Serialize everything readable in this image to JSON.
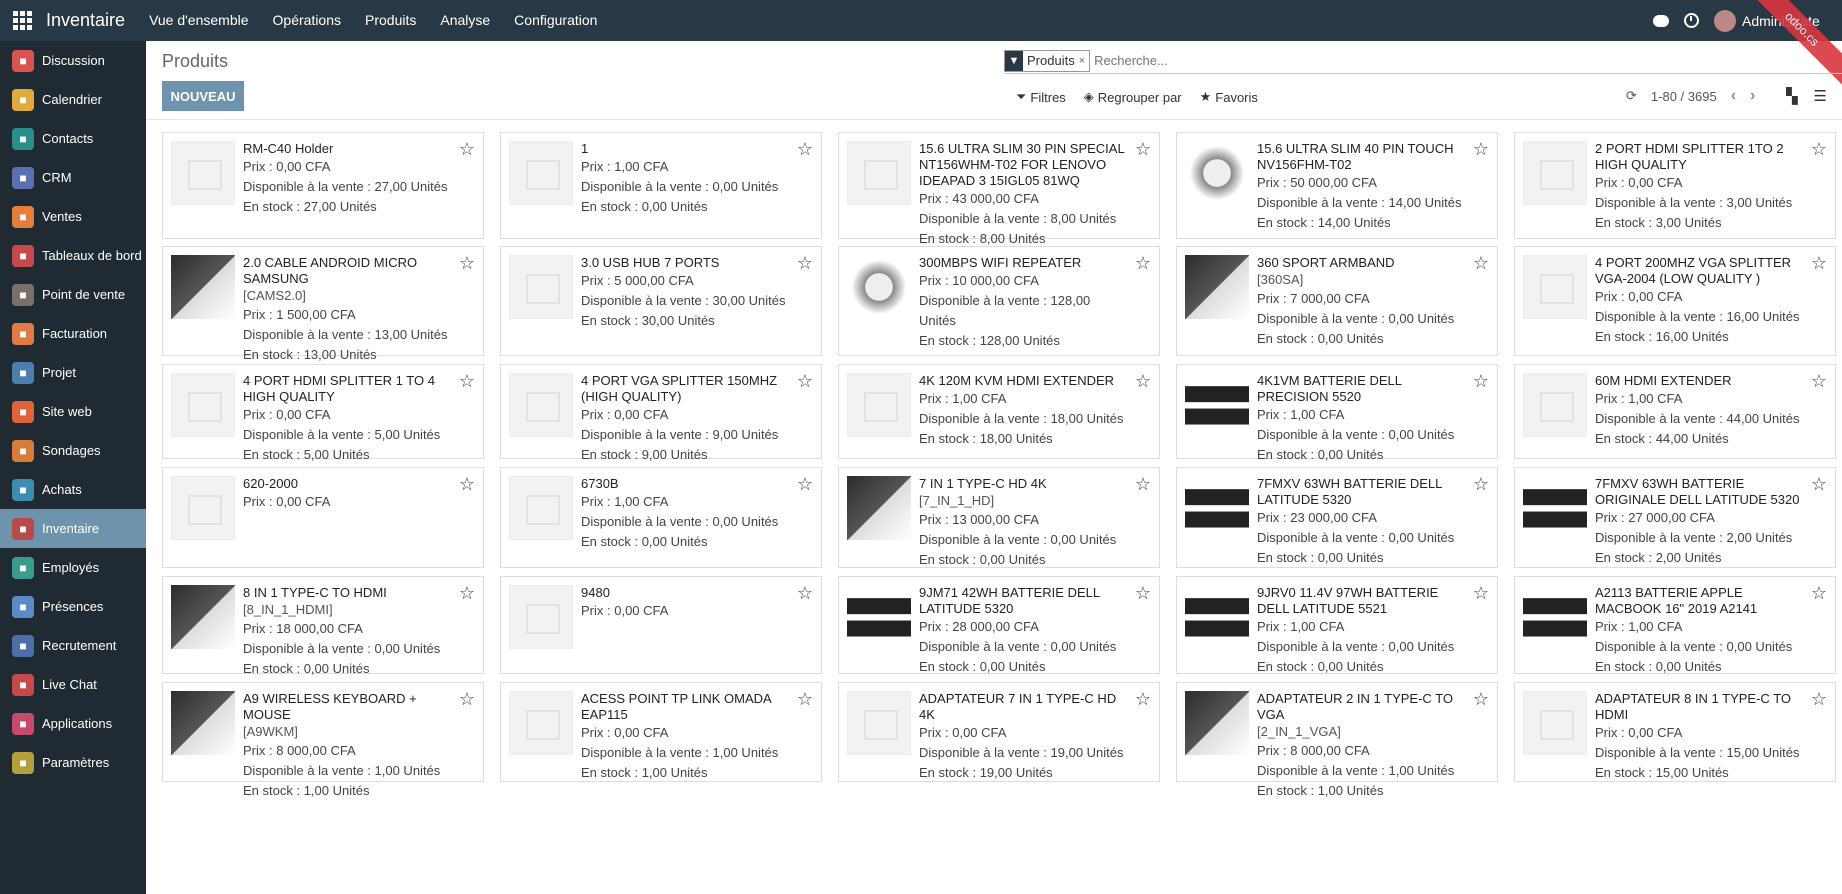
{
  "topbar": {
    "brand": "Inventaire",
    "menu": [
      "Vue d'ensemble",
      "Opérations",
      "Produits",
      "Analyse",
      "Configuration"
    ],
    "user": "Administrate",
    "ribbon": "odoo.cs"
  },
  "sidebar": {
    "items": [
      {
        "label": "Discussion",
        "color": "#d9534f"
      },
      {
        "label": "Calendrier",
        "color": "#e2a93b"
      },
      {
        "label": "Contacts",
        "color": "#2c8e8a"
      },
      {
        "label": "CRM",
        "color": "#5b6fb3"
      },
      {
        "label": "Ventes",
        "color": "#e67e3c"
      },
      {
        "label": "Tableaux de bord",
        "color": "#c74a4a"
      },
      {
        "label": "Point de vente",
        "color": "#7a6f6a"
      },
      {
        "label": "Facturation",
        "color": "#e07b45"
      },
      {
        "label": "Projet",
        "color": "#4a7fb0"
      },
      {
        "label": "Site web",
        "color": "#e0633a"
      },
      {
        "label": "Sondages",
        "color": "#d97c3a"
      },
      {
        "label": "Achats",
        "color": "#3c8db0"
      },
      {
        "label": "Inventaire",
        "color": "#b94a4a"
      },
      {
        "label": "Employés",
        "color": "#3a9c8a"
      },
      {
        "label": "Présences",
        "color": "#5a8ac7"
      },
      {
        "label": "Recrutement",
        "color": "#4d6ea8"
      },
      {
        "label": "Live Chat",
        "color": "#c74a4a"
      },
      {
        "label": "Applications",
        "color": "#c74a6a"
      },
      {
        "label": "Paramètres",
        "color": "#b3a03a"
      }
    ],
    "active_index": 12
  },
  "control": {
    "title": "Produits",
    "new_label": "NOUVEAU",
    "facet_label": "Produits",
    "search_placeholder": "Recherche...",
    "filters_label": "Filtres",
    "groupby_label": "Regrouper par",
    "favorites_label": "Favoris",
    "pager": "1-80 / 3695"
  },
  "products": [
    {
      "name": "RM-C40 Holder",
      "ref": "",
      "price": "Prix : 0,00 CFA",
      "avail": "Disponible à la vente : 27,00 Unités",
      "stock": "En stock : 27,00 Unités",
      "img": "placeholder"
    },
    {
      "name": "1",
      "ref": "",
      "price": "Prix : 1,00 CFA",
      "avail": "Disponible à la vente : 0,00 Unités",
      "stock": "En stock : 0,00 Unités",
      "img": "placeholder"
    },
    {
      "name": "15.6 ULTRA SLIM 30 PIN SPECIAL NT156WHM-T02 FOR LENOVO IDEAPAD 3 15IGL05 81WQ",
      "ref": "",
      "price": "Prix : 43 000,00 CFA",
      "avail": "Disponible à la vente : 8,00 Unités",
      "stock": "En stock : 8,00 Unités",
      "img": "placeholder"
    },
    {
      "name": "15.6 ULTRA SLIM 40 PIN TOUCH NV156FHM-T02",
      "ref": "",
      "price": "Prix : 50 000,00 CFA",
      "avail": "Disponible à la vente : 14,00 Unités",
      "stock": "En stock : 14,00 Unités",
      "img": "photo2"
    },
    {
      "name": "2 PORT HDMI SPLITTER  1TO 2  HIGH QUALITY",
      "ref": "",
      "price": "Prix : 0,00 CFA",
      "avail": "Disponible à la vente : 3,00 Unités",
      "stock": "En stock : 3,00 Unités",
      "img": "placeholder"
    },
    {
      "name": "2.0 CABLE ANDROID MICRO SAMSUNG",
      "ref": "[CAMS2.0]",
      "price": "Prix : 1 500,00 CFA",
      "avail": "Disponible à la vente : 13,00 Unités",
      "stock": "En stock : 13,00 Unités",
      "img": "photo"
    },
    {
      "name": "3.0 USB HUB 7 PORTS",
      "ref": "",
      "price": "Prix : 5 000,00 CFA",
      "avail": "Disponible à la vente : 30,00 Unités",
      "stock": "En stock : 30,00 Unités",
      "img": "placeholder"
    },
    {
      "name": "300MBPS WIFI REPEATER",
      "ref": "",
      "price": "Prix : 10 000,00 CFA",
      "avail": "Disponible à la vente : 128,00 Unités",
      "stock": "En stock : 128,00 Unités",
      "img": "photo2"
    },
    {
      "name": "360 SPORT ARMBAND",
      "ref": "[360SA]",
      "price": "Prix : 7 000,00 CFA",
      "avail": "Disponible à la vente : 0,00 Unités",
      "stock": "En stock : 0,00 Unités",
      "img": "photo"
    },
    {
      "name": "4 PORT 200MHZ VGA SPLITTER  VGA-2004 (LOW QUALITY )",
      "ref": "",
      "price": "Prix : 0,00 CFA",
      "avail": "Disponible à la vente : 16,00 Unités",
      "stock": "En stock : 16,00 Unités",
      "img": "placeholder"
    },
    {
      "name": "4 PORT HDMI SPLITTER 1 TO 4  HIGH QUALITY",
      "ref": "",
      "price": "Prix : 0,00 CFA",
      "avail": "Disponible à la vente : 5,00 Unités",
      "stock": "En stock : 5,00 Unités",
      "img": "placeholder"
    },
    {
      "name": "4 PORT VGA SPLITTER 150MHZ  (HIGH QUALITY)",
      "ref": "",
      "price": "Prix : 0,00 CFA",
      "avail": "Disponible à la vente : 9,00 Unités",
      "stock": "En stock : 9,00 Unités",
      "img": "placeholder"
    },
    {
      "name": "4K 120M KVM HDMI EXTENDER",
      "ref": "",
      "price": "Prix : 1,00 CFA",
      "avail": "Disponible à la vente : 18,00 Unités",
      "stock": "En stock : 18,00 Unités",
      "img": "placeholder"
    },
    {
      "name": "4K1VM BATTERIE DELL PRECISION 5520",
      "ref": "",
      "price": "Prix : 1,00 CFA",
      "avail": "Disponible à la vente : 0,00 Unités",
      "stock": "En stock : 0,00 Unités",
      "img": "battery"
    },
    {
      "name": "60M HDMI EXTENDER",
      "ref": "",
      "price": "Prix : 1,00 CFA",
      "avail": "Disponible à la vente : 44,00 Unités",
      "stock": "En stock : 44,00 Unités",
      "img": "placeholder"
    },
    {
      "name": "620-2000",
      "ref": "",
      "price": "Prix : 0,00 CFA",
      "avail": "",
      "stock": "",
      "img": "placeholder"
    },
    {
      "name": "6730B",
      "ref": "",
      "price": "Prix : 1,00 CFA",
      "avail": "Disponible à la vente : 0,00 Unités",
      "stock": "En stock : 0,00 Unités",
      "img": "placeholder"
    },
    {
      "name": "7 IN 1 TYPE-C HD 4K",
      "ref": "[7_IN_1_HD]",
      "price": "Prix : 13 000,00 CFA",
      "avail": "Disponible à la vente : 0,00 Unités",
      "stock": "En stock : 0,00 Unités",
      "img": "photo"
    },
    {
      "name": "7FMXV 63WH BATTERIE DELL LATITUDE 5320",
      "ref": "",
      "price": "Prix : 23 000,00 CFA",
      "avail": "Disponible à la vente : 0,00 Unités",
      "stock": "En stock : 0,00 Unités",
      "img": "battery"
    },
    {
      "name": "7FMXV 63WH BATTERIE ORIGINALE DELL LATITUDE 5320",
      "ref": "",
      "price": "Prix : 27 000,00 CFA",
      "avail": "Disponible à la vente : 2,00 Unités",
      "stock": "En stock : 2,00 Unités",
      "img": "battery"
    },
    {
      "name": "8 IN 1 TYPE-C TO HDMI",
      "ref": "[8_IN_1_HDMI]",
      "price": "Prix : 18 000,00 CFA",
      "avail": "Disponible à la vente : 0,00 Unités",
      "stock": "En stock : 0,00 Unités",
      "img": "photo"
    },
    {
      "name": "9480",
      "ref": "",
      "price": "Prix : 0,00 CFA",
      "avail": "",
      "stock": "",
      "img": "placeholder"
    },
    {
      "name": "9JM71 42WH BATTERIE DELL LATITUDE 5320",
      "ref": "",
      "price": "Prix : 28 000,00 CFA",
      "avail": "Disponible à la vente : 0,00 Unités",
      "stock": "En stock : 0,00 Unités",
      "img": "battery"
    },
    {
      "name": "9JRV0 11.4V 97WH BATTERIE DELL LATITUDE 5521",
      "ref": "",
      "price": "Prix : 1,00 CFA",
      "avail": "Disponible à la vente : 0,00 Unités",
      "stock": "En stock : 0,00 Unités",
      "img": "battery"
    },
    {
      "name": "A2113 BATTERIE APPLE MACBOOK 16\" 2019 A2141",
      "ref": "",
      "price": "Prix : 1,00 CFA",
      "avail": "Disponible à la vente : 0,00 Unités",
      "stock": "En stock : 0,00 Unités",
      "img": "battery"
    },
    {
      "name": "A9 WIRELESS KEYBOARD + MOUSE",
      "ref": "[A9WKM]",
      "price": "Prix : 8 000,00 CFA",
      "avail": "Disponible à la vente : 1,00 Unités",
      "stock": "En stock : 1,00 Unités",
      "img": "photo"
    },
    {
      "name": "ACESS POINT TP LINK OMADA EAP115",
      "ref": "",
      "price": "Prix : 0,00 CFA",
      "avail": "Disponible à la vente : 1,00 Unités",
      "stock": "En stock : 1,00 Unités",
      "img": "placeholder"
    },
    {
      "name": "ADAPTATEUR 7 IN 1 TYPE-C HD 4K",
      "ref": "",
      "price": "Prix : 0,00 CFA",
      "avail": "Disponible à la vente : 19,00 Unités",
      "stock": "En stock : 19,00 Unités",
      "img": "placeholder"
    },
    {
      "name": "ADAPTATEUR 2 IN 1 TYPE-C TO VGA",
      "ref": "[2_IN_1_VGA]",
      "price": "Prix : 8 000,00 CFA",
      "avail": "Disponible à la vente : 1,00 Unités",
      "stock": "En stock : 1,00 Unités",
      "img": "photo"
    },
    {
      "name": "ADAPTATEUR 8 IN 1 TYPE-C TO HDMI",
      "ref": "",
      "price": "Prix : 0,00 CFA",
      "avail": "Disponible à la vente : 15,00 Unités",
      "stock": "En stock : 15,00 Unités",
      "img": "placeholder"
    }
  ]
}
